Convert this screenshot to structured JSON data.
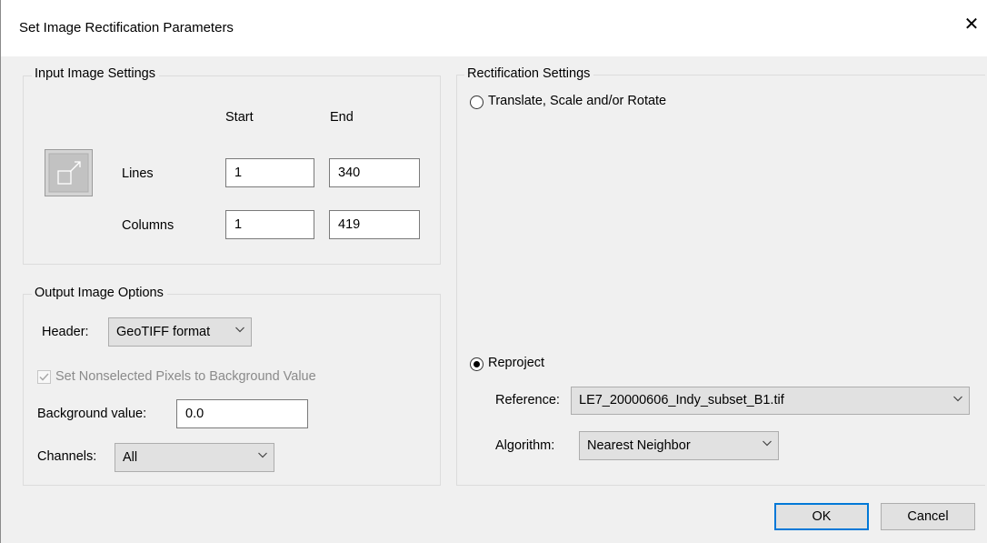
{
  "window": {
    "title": "Set Image Rectification Parameters",
    "close_label": "✕"
  },
  "input_settings": {
    "legend": "Input Image Settings",
    "start_header": "Start",
    "end_header": "End",
    "lines_label": "Lines",
    "columns_label": "Columns",
    "lines_start": "1",
    "lines_end": "340",
    "columns_start": "1",
    "columns_end": "419",
    "icon": "window-region-select-icon"
  },
  "output_options": {
    "legend": "Output Image Options",
    "header_label": "Header:",
    "header_value": "GeoTIFF format",
    "nonselected_label": "Set Nonselected Pixels to Background Value",
    "nonselected_checked": true,
    "nonselected_disabled": true,
    "background_label": "Background value:",
    "background_value": "0.0",
    "channels_label": "Channels:",
    "channels_value": "All"
  },
  "rectification": {
    "legend": "Rectification Settings",
    "option_translate_label": "Translate, Scale and/or Rotate",
    "option_translate_selected": false,
    "option_reproject_label": "Reproject",
    "option_reproject_selected": true,
    "reference_label": "Reference:",
    "reference_value": "LE7_20000606_Indy_subset_B1.tif",
    "algorithm_label": "Algorithm:",
    "algorithm_value": "Nearest Neighbor"
  },
  "buttons": {
    "ok": "OK",
    "cancel": "Cancel"
  },
  "colors": {
    "background": "#f0f0f0",
    "default_button_border": "#0078d7",
    "disabled_text": "#8a8a8a"
  }
}
